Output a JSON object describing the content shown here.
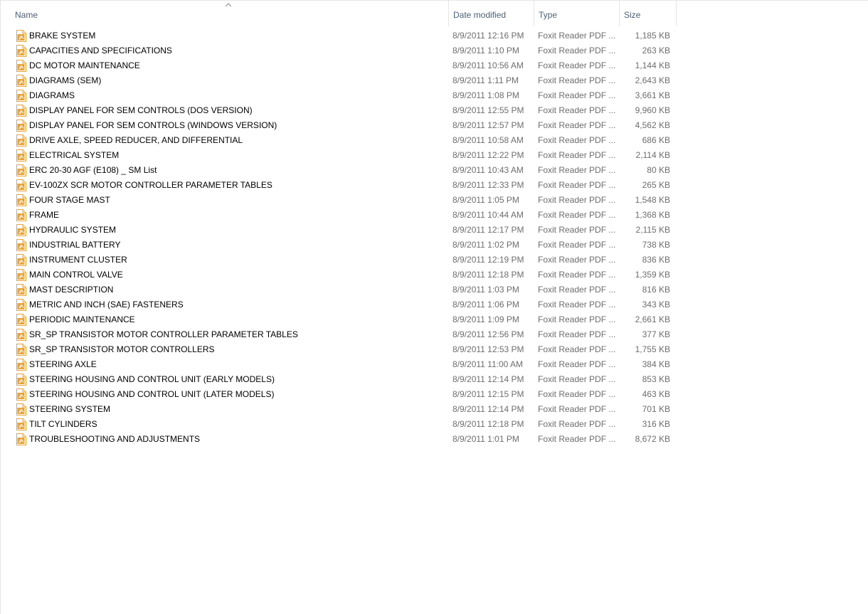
{
  "columns": {
    "name": "Name",
    "date_modified": "Date modified",
    "type": "Type",
    "size": "Size"
  },
  "sort": {
    "column": "name",
    "direction": "ascending",
    "icon": "chevron-up-icon"
  },
  "colors": {
    "header_text": "#4c607a",
    "secondary_text": "#6d6d6d",
    "pdf_icon": "#e8a33b"
  },
  "files": [
    {
      "name": "BRAKE SYSTEM",
      "date": "8/9/2011 12:16 PM",
      "type": "Foxit Reader PDF ...",
      "size": "1,185 KB"
    },
    {
      "name": "CAPACITIES AND SPECIFICATIONS",
      "date": "8/9/2011 1:10 PM",
      "type": "Foxit Reader PDF ...",
      "size": "263 KB"
    },
    {
      "name": "DC MOTOR MAINTENANCE",
      "date": "8/9/2011 10:56 AM",
      "type": "Foxit Reader PDF ...",
      "size": "1,144 KB"
    },
    {
      "name": "DIAGRAMS (SEM)",
      "date": "8/9/2011 1:11 PM",
      "type": "Foxit Reader PDF ...",
      "size": "2,643 KB"
    },
    {
      "name": "DIAGRAMS",
      "date": "8/9/2011 1:08 PM",
      "type": "Foxit Reader PDF ...",
      "size": "3,661 KB"
    },
    {
      "name": "DISPLAY PANEL FOR SEM CONTROLS (DOS VERSION)",
      "date": "8/9/2011 12:55 PM",
      "type": "Foxit Reader PDF ...",
      "size": "9,960 KB"
    },
    {
      "name": "DISPLAY PANEL FOR SEM CONTROLS (WINDOWS VERSION)",
      "date": "8/9/2011 12:57 PM",
      "type": "Foxit Reader PDF ...",
      "size": "4,562 KB"
    },
    {
      "name": "DRIVE AXLE, SPEED REDUCER, AND DIFFERENTIAL",
      "date": "8/9/2011 10:58 AM",
      "type": "Foxit Reader PDF ...",
      "size": "686 KB"
    },
    {
      "name": "ELECTRICAL SYSTEM",
      "date": "8/9/2011 12:22 PM",
      "type": "Foxit Reader PDF ...",
      "size": "2,114 KB"
    },
    {
      "name": "ERC 20-30 AGF (E108) _ SM List",
      "date": "8/9/2011 10:43 AM",
      "type": "Foxit Reader PDF ...",
      "size": "80 KB"
    },
    {
      "name": "EV-100ZX SCR MOTOR CONTROLLER PARAMETER TABLES",
      "date": "8/9/2011 12:33 PM",
      "type": "Foxit Reader PDF ...",
      "size": "265 KB"
    },
    {
      "name": "FOUR STAGE MAST",
      "date": "8/9/2011 1:05 PM",
      "type": "Foxit Reader PDF ...",
      "size": "1,548 KB"
    },
    {
      "name": "FRAME",
      "date": "8/9/2011 10:44 AM",
      "type": "Foxit Reader PDF ...",
      "size": "1,368 KB"
    },
    {
      "name": "HYDRAULIC SYSTEM",
      "date": "8/9/2011 12:17 PM",
      "type": "Foxit Reader PDF ...",
      "size": "2,115 KB"
    },
    {
      "name": "INDUSTRIAL BATTERY",
      "date": "8/9/2011 1:02 PM",
      "type": "Foxit Reader PDF ...",
      "size": "738 KB"
    },
    {
      "name": "INSTRUMENT CLUSTER",
      "date": "8/9/2011 12:19 PM",
      "type": "Foxit Reader PDF ...",
      "size": "836 KB"
    },
    {
      "name": "MAIN CONTROL VALVE",
      "date": "8/9/2011 12:18 PM",
      "type": "Foxit Reader PDF ...",
      "size": "1,359 KB"
    },
    {
      "name": "MAST DESCRIPTION",
      "date": "8/9/2011 1:03 PM",
      "type": "Foxit Reader PDF ...",
      "size": "816 KB"
    },
    {
      "name": "METRIC AND INCH (SAE) FASTENERS",
      "date": "8/9/2011 1:06 PM",
      "type": "Foxit Reader PDF ...",
      "size": "343 KB"
    },
    {
      "name": "PERIODIC MAINTENANCE",
      "date": "8/9/2011 1:09 PM",
      "type": "Foxit Reader PDF ...",
      "size": "2,661 KB"
    },
    {
      "name": "SR_SP TRANSISTOR MOTOR CONTROLLER PARAMETER TABLES",
      "date": "8/9/2011 12:56 PM",
      "type": "Foxit Reader PDF ...",
      "size": "377 KB"
    },
    {
      "name": "SR_SP TRANSISTOR MOTOR CONTROLLERS",
      "date": "8/9/2011 12:53 PM",
      "type": "Foxit Reader PDF ...",
      "size": "1,755 KB"
    },
    {
      "name": "STEERING AXLE",
      "date": "8/9/2011 11:00 AM",
      "type": "Foxit Reader PDF ...",
      "size": "384 KB"
    },
    {
      "name": "STEERING HOUSING AND CONTROL UNIT (EARLY MODELS)",
      "date": "8/9/2011 12:14 PM",
      "type": "Foxit Reader PDF ...",
      "size": "853 KB"
    },
    {
      "name": "STEERING HOUSING AND CONTROL UNIT (LATER MODELS)",
      "date": "8/9/2011 12:15 PM",
      "type": "Foxit Reader PDF ...",
      "size": "463 KB"
    },
    {
      "name": "STEERING SYSTEM",
      "date": "8/9/2011 12:14 PM",
      "type": "Foxit Reader PDF ...",
      "size": "701 KB"
    },
    {
      "name": "TILT CYLINDERS",
      "date": "8/9/2011 12:18 PM",
      "type": "Foxit Reader PDF ...",
      "size": "316 KB"
    },
    {
      "name": "TROUBLESHOOTING AND ADJUSTMENTS",
      "date": "8/9/2011 1:01 PM",
      "type": "Foxit Reader PDF ...",
      "size": "8,672 KB"
    }
  ]
}
